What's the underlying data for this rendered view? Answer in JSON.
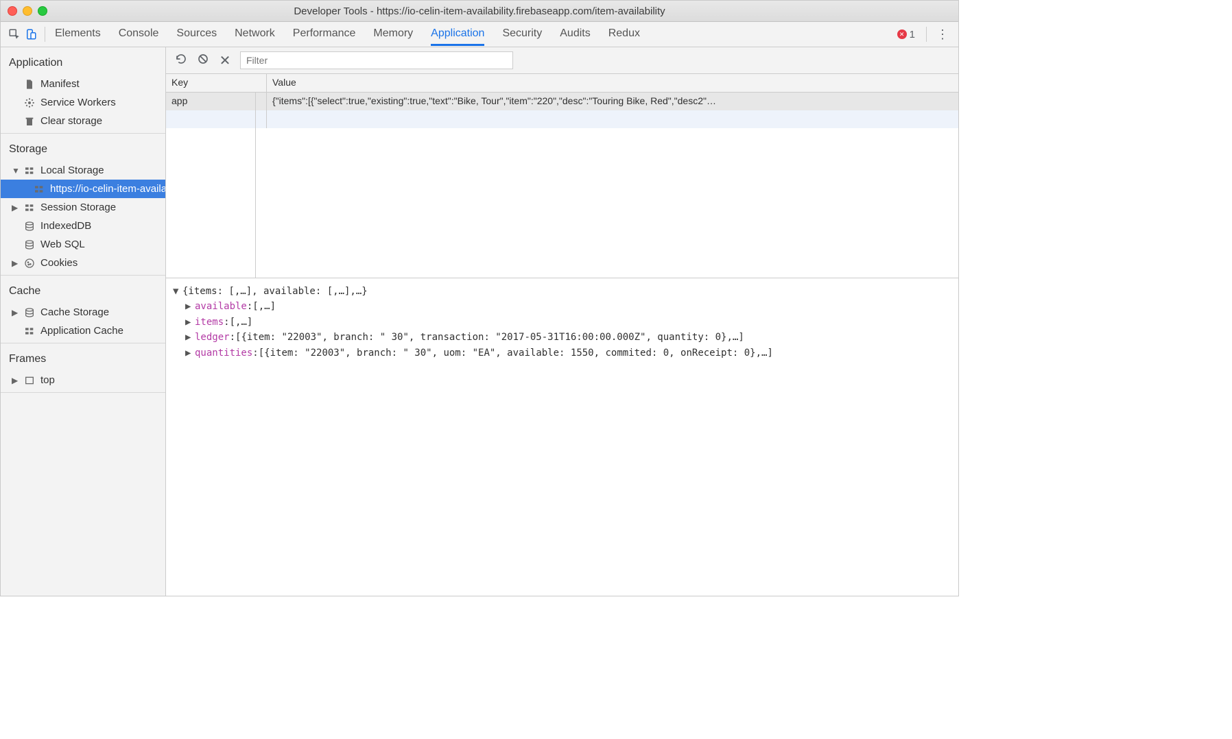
{
  "window": {
    "title": "Developer Tools - https://io-celin-item-availability.firebaseapp.com/item-availability"
  },
  "tabs": {
    "items": [
      "Elements",
      "Console",
      "Sources",
      "Network",
      "Performance",
      "Memory",
      "Application",
      "Security",
      "Audits",
      "Redux"
    ],
    "active": "Application",
    "error_count": "1"
  },
  "sidebar": {
    "groups": [
      {
        "title": "Application",
        "items": [
          {
            "label": "Manifest",
            "icon": "file"
          },
          {
            "label": "Service Workers",
            "icon": "gear"
          },
          {
            "label": "Clear storage",
            "icon": "trash"
          }
        ]
      },
      {
        "title": "Storage",
        "items": [
          {
            "label": "Local Storage",
            "icon": "grid",
            "expandable": true,
            "expanded": true,
            "children": [
              {
                "label": "https://io-celin-item-availab",
                "icon": "grid",
                "selected": true
              }
            ]
          },
          {
            "label": "Session Storage",
            "icon": "grid",
            "expandable": true,
            "expanded": false
          },
          {
            "label": "IndexedDB",
            "icon": "db"
          },
          {
            "label": "Web SQL",
            "icon": "db"
          },
          {
            "label": "Cookies",
            "icon": "cookie",
            "expandable": true,
            "expanded": false
          }
        ]
      },
      {
        "title": "Cache",
        "items": [
          {
            "label": "Cache Storage",
            "icon": "db",
            "expandable": true,
            "expanded": false
          },
          {
            "label": "Application Cache",
            "icon": "grid"
          }
        ]
      },
      {
        "title": "Frames",
        "items": [
          {
            "label": "top",
            "icon": "frame",
            "expandable": true,
            "expanded": false
          }
        ]
      }
    ]
  },
  "toolbar": {
    "filter_placeholder": "Filter"
  },
  "kv": {
    "headers": {
      "key": "Key",
      "value": "Value"
    },
    "rows": [
      {
        "key": "app",
        "value": "{\"items\":[{\"select\":true,\"existing\":true,\"text\":\"Bike, Tour\",\"item\":\"220\",\"desc\":\"Touring Bike, Red\",\"desc2\"…"
      }
    ]
  },
  "inspector": {
    "root_summary": "{items: [,…], available: [,…],…}",
    "children": [
      {
        "prop": "available",
        "summary": "[,…]"
      },
      {
        "prop": "items",
        "summary": "[,…]"
      },
      {
        "prop": "ledger",
        "summary": "[{item: \"22003\", branch: \" 30\", transaction: \"2017-05-31T16:00:00.000Z\", quantity: 0},…]"
      },
      {
        "prop": "quantities",
        "summary": "[{item: \"22003\", branch: \" 30\", uom: \"EA\", available: 1550, commited: 0, onReceipt: 0},…]"
      }
    ]
  }
}
